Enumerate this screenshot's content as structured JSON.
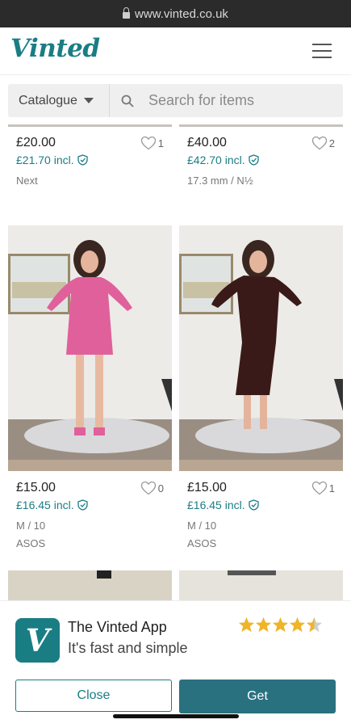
{
  "browser": {
    "url": "www.vinted.co.uk"
  },
  "header": {
    "logo": "Vinted"
  },
  "search": {
    "catalogue_label": "Catalogue",
    "placeholder": "Search for items"
  },
  "items_top": [
    {
      "price": "£20.00",
      "price_incl": "£21.70 incl.",
      "favourites": "1",
      "size": "",
      "brand": "Next"
    },
    {
      "price": "£40.00",
      "price_incl": "£42.70 incl.",
      "favourites": "2",
      "size": "17.3 mm / N½",
      "brand": ""
    }
  ],
  "items_mid": [
    {
      "price": "£15.00",
      "price_incl": "£16.45 incl.",
      "favourites": "0",
      "size": "M / 10",
      "brand": "ASOS",
      "dress_color": "#e0609b"
    },
    {
      "price": "£15.00",
      "price_incl": "£16.45 incl.",
      "favourites": "1",
      "size": "M / 10",
      "brand": "ASOS",
      "dress_color": "#3a1a18"
    }
  ],
  "app_banner": {
    "app_name": "The Vinted App",
    "tagline": "It's fast and simple",
    "rating": 4.5,
    "close_label": "Close",
    "get_label": "Get"
  },
  "colors": {
    "brand": "#1a7d84",
    "get_button": "#2a7180",
    "star": "#f0b429"
  }
}
